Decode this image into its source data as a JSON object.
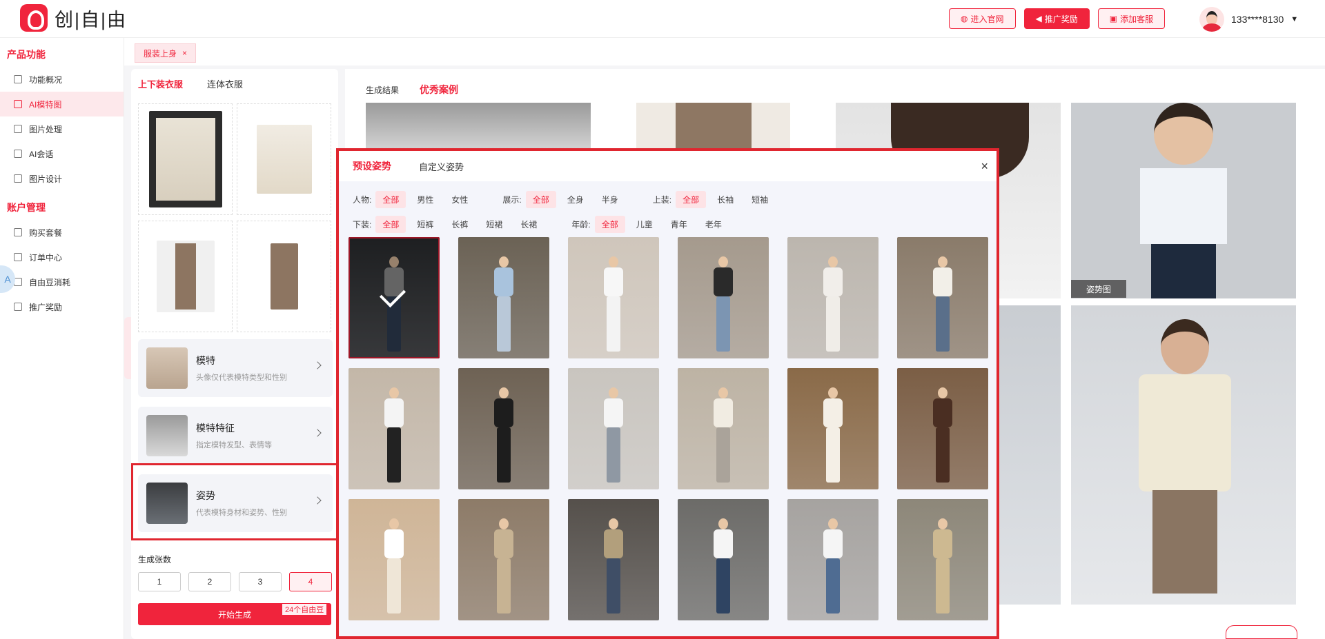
{
  "app": {
    "logo_text": "创|自|由"
  },
  "top_actions": [
    {
      "label": "进入官网"
    },
    {
      "label": "推广奖励"
    },
    {
      "label": "添加客服"
    }
  ],
  "user": {
    "phone": "133****8130"
  },
  "sidebar": {
    "sections": [
      {
        "title": "产品功能",
        "items": [
          {
            "label": "功能概况",
            "icon": "grid-icon"
          },
          {
            "label": "AI模特图",
            "icon": "model-icon",
            "active": true
          },
          {
            "label": "图片处理",
            "icon": "image-icon"
          },
          {
            "label": "AI会话",
            "icon": "chat-icon"
          },
          {
            "label": "图片设计",
            "icon": "design-icon"
          }
        ]
      },
      {
        "title": "账户管理",
        "items": [
          {
            "label": "购买套餐",
            "icon": "cart-icon"
          },
          {
            "label": "订单中心",
            "icon": "order-icon"
          },
          {
            "label": "自由豆消耗",
            "icon": "coin-icon"
          },
          {
            "label": "推广奖励",
            "icon": "megaphone-icon"
          }
        ]
      }
    ]
  },
  "tabbar": {
    "tag": "服装上身"
  },
  "left_panel": {
    "tabs": [
      "上下装衣服",
      "连体衣服"
    ],
    "options": [
      {
        "title": "模特",
        "desc": "头像仅代表模特类型和性别"
      },
      {
        "title": "模特特征",
        "desc": "指定模特发型、表情等"
      },
      {
        "title": "姿势",
        "desc": "代表模特身材和姿势、性别"
      }
    ],
    "count_label": "生成张数",
    "counts": [
      "1",
      "2",
      "3",
      "4"
    ],
    "selected_count": "4",
    "generate_label": "开始生成",
    "cost_label": "24个自由豆"
  },
  "right_panel": {
    "tabs": [
      "生成结果",
      "优秀案例"
    ],
    "pose_tag": "姿势图"
  },
  "modal": {
    "tabs": [
      "预设姿势",
      "自定义姿势"
    ],
    "close": "×",
    "filters": {
      "row1": [
        {
          "label": "人物:",
          "options": [
            "全部",
            "男性",
            "女性"
          ],
          "selected": "全部"
        },
        {
          "label": "展示:",
          "options": [
            "全部",
            "全身",
            "半身"
          ],
          "selected": "全部"
        },
        {
          "label": "上装:",
          "options": [
            "全部",
            "长袖",
            "短袖"
          ],
          "selected": "全部"
        }
      ],
      "row2": [
        {
          "label": "下装:",
          "options": [
            "全部",
            "短裤",
            "长裤",
            "短裙",
            "长裙"
          ],
          "selected": "全部"
        },
        {
          "label": "年龄:",
          "options": [
            "全部",
            "儿童",
            "青年",
            "老年"
          ],
          "selected": "全部"
        }
      ]
    },
    "poses": [
      {
        "bg": "#2e3033",
        "top": "#9a9a9a",
        "bottom": "#34435a",
        "selected": true
      },
      {
        "bg": "#6b6255",
        "top": "#a9c3dd",
        "bottom": "#b9c8d8"
      },
      {
        "bg": "#cfc6bb",
        "top": "#f7f7f7",
        "bottom": "#f3f3f3"
      },
      {
        "bg": "#a59a8d",
        "top": "#2a2a2a",
        "bottom": "#7c95b2"
      },
      {
        "bg": "#bcb6ae",
        "top": "#f1eeea",
        "bottom": "#f0ede8"
      },
      {
        "bg": "#8a7b6a",
        "top": "#f2efe8",
        "bottom": "#5a6f8a"
      },
      {
        "bg": "#c3b7a8",
        "top": "#f4f4f4",
        "bottom": "#222222"
      },
      {
        "bg": "#6e6254",
        "top": "#1d1d1d",
        "bottom": "#1d1d1d"
      },
      {
        "bg": "#c9c5bf",
        "top": "#f5f5f5",
        "bottom": "#8f98a3"
      },
      {
        "bg": "#bdb3a4",
        "top": "#f1ece2",
        "bottom": "#aaa39a"
      },
      {
        "bg": "#8a6a48",
        "top": "#f4efe6",
        "bottom": "#f4efe6"
      },
      {
        "bg": "#7b5e45",
        "top": "#4a2e22",
        "bottom": "#4a2e22"
      },
      {
        "bg": "#cfb597",
        "top": "#ffffff",
        "bottom": "#efe6d7"
      },
      {
        "bg": "#8d7b68",
        "top": "#c7b393",
        "bottom": "#c7b393"
      },
      {
        "bg": "#55504b",
        "top": "#b29f7c",
        "bottom": "#3f4e66"
      },
      {
        "bg": "#6c6b68",
        "top": "#f5f5f5",
        "bottom": "#2f4462"
      },
      {
        "bg": "#a6a3a0",
        "top": "#f5f5f5",
        "bottom": "#4f6c92"
      },
      {
        "bg": "#8d8779",
        "top": "#cdb991",
        "bottom": "#cdb991"
      }
    ]
  },
  "colors": {
    "accent": "#f0243c"
  }
}
